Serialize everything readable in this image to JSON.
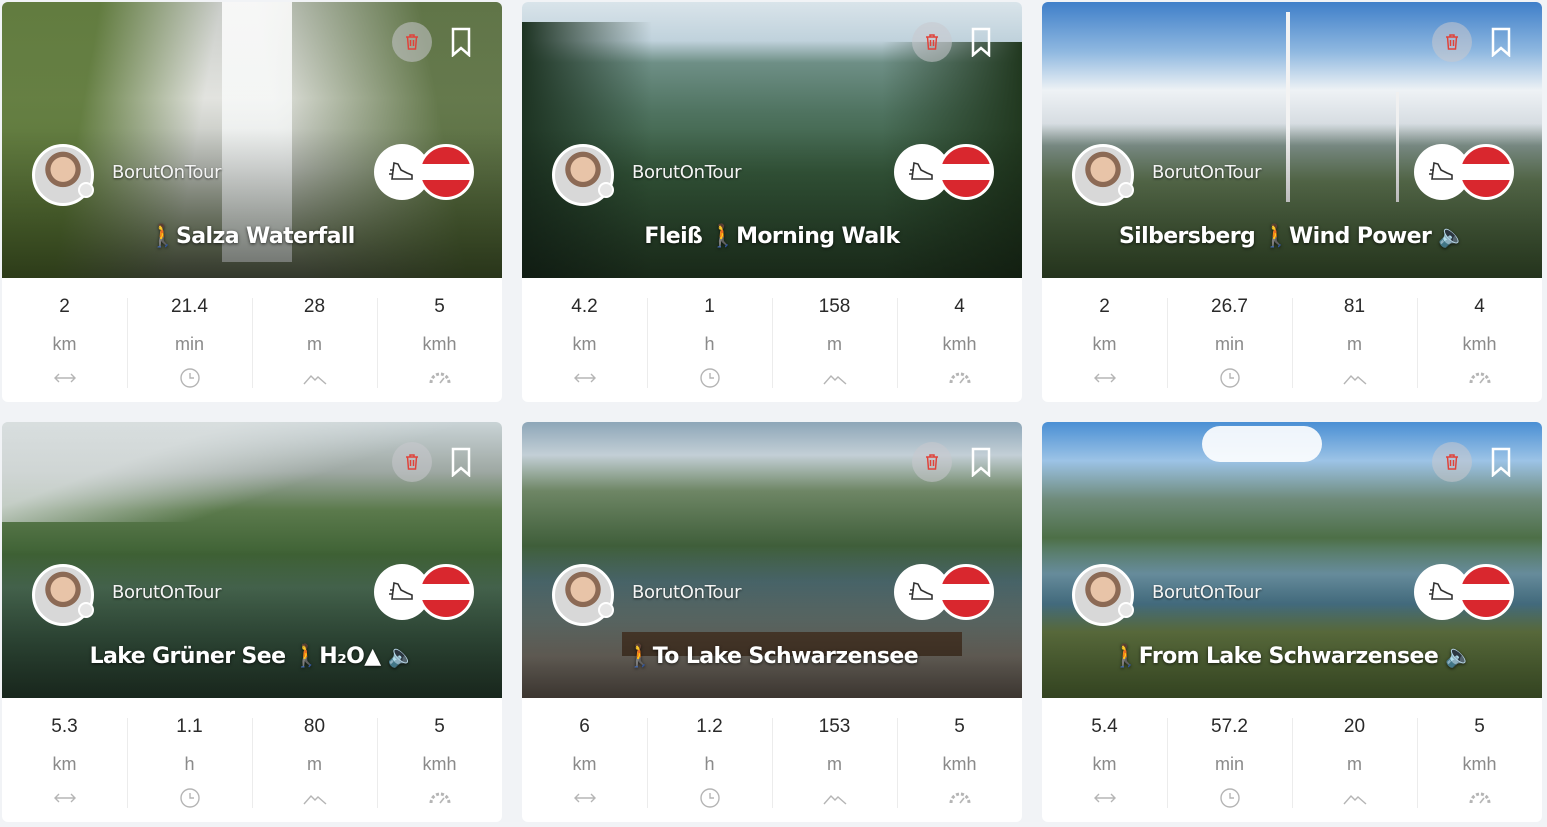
{
  "cards": [
    {
      "author": "BorutOnTour",
      "title": "🚶Salza Waterfall",
      "stats": [
        {
          "value": "2",
          "unit": "km",
          "icon": "distance-icon"
        },
        {
          "value": "21.4",
          "unit": "min",
          "icon": "clock-icon"
        },
        {
          "value": "28",
          "unit": "m",
          "icon": "elevation-icon"
        },
        {
          "value": "5",
          "unit": "kmh",
          "icon": "speedometer-icon"
        }
      ]
    },
    {
      "author": "BorutOnTour",
      "title": "Fleiß 🚶Morning Walk",
      "stats": [
        {
          "value": "4.2",
          "unit": "km",
          "icon": "distance-icon"
        },
        {
          "value": "1",
          "unit": "h",
          "icon": "clock-icon"
        },
        {
          "value": "158",
          "unit": "m",
          "icon": "elevation-icon"
        },
        {
          "value": "4",
          "unit": "kmh",
          "icon": "speedometer-icon"
        }
      ]
    },
    {
      "author": "BorutOnTour",
      "title": "Silbersberg 🚶Wind Power 🔈",
      "stats": [
        {
          "value": "2",
          "unit": "km",
          "icon": "distance-icon"
        },
        {
          "value": "26.7",
          "unit": "min",
          "icon": "clock-icon"
        },
        {
          "value": "81",
          "unit": "m",
          "icon": "elevation-icon"
        },
        {
          "value": "4",
          "unit": "kmh",
          "icon": "speedometer-icon"
        }
      ]
    },
    {
      "author": "BorutOnTour",
      "title": "Lake Grüner See 🚶H₂O▲ 🔈",
      "stats": [
        {
          "value": "5.3",
          "unit": "km",
          "icon": "distance-icon"
        },
        {
          "value": "1.1",
          "unit": "h",
          "icon": "clock-icon"
        },
        {
          "value": "80",
          "unit": "m",
          "icon": "elevation-icon"
        },
        {
          "value": "5",
          "unit": "kmh",
          "icon": "speedometer-icon"
        }
      ]
    },
    {
      "author": "BorutOnTour",
      "title": "🚶To Lake Schwarzensee",
      "stats": [
        {
          "value": "6",
          "unit": "km",
          "icon": "distance-icon"
        },
        {
          "value": "1.2",
          "unit": "h",
          "icon": "clock-icon"
        },
        {
          "value": "153",
          "unit": "m",
          "icon": "elevation-icon"
        },
        {
          "value": "5",
          "unit": "kmh",
          "icon": "speedometer-icon"
        }
      ]
    },
    {
      "author": "BorutOnTour",
      "title": "🚶From Lake Schwarzensee 🔈",
      "stats": [
        {
          "value": "5.4",
          "unit": "km",
          "icon": "distance-icon"
        },
        {
          "value": "57.2",
          "unit": "min",
          "icon": "clock-icon"
        },
        {
          "value": "20",
          "unit": "m",
          "icon": "elevation-icon"
        },
        {
          "value": "5",
          "unit": "kmh",
          "icon": "speedometer-icon"
        }
      ]
    }
  ],
  "colors": {
    "delete_icon": "#e0423a",
    "flag_red": "#d9272e",
    "stat_icon": "#b5b5b5"
  }
}
